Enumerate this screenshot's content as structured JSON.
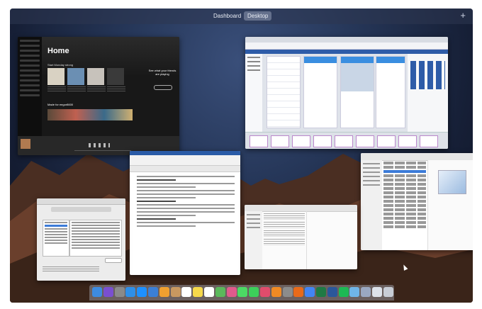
{
  "spaces": {
    "tabs": [
      {
        "label": "Dashboard",
        "active": false
      },
      {
        "label": "Desktop",
        "active": true
      }
    ],
    "add_label": "+"
  },
  "colors": {
    "spotify_bg": "#181818",
    "accent_blue": "#2e5ca8",
    "selection_blue": "#3c7bd8"
  },
  "spotify": {
    "title": "Home",
    "sections": [
      "Start Monday strong",
      "Made for eegor8600"
    ],
    "promo": "See what your friends are playing"
  },
  "dock": {
    "icons": [
      {
        "name": "finder-icon",
        "color": "#3d8be0"
      },
      {
        "name": "siri-icon",
        "color": "#7a4fd0"
      },
      {
        "name": "launchpad-icon",
        "color": "#8a8a8a"
      },
      {
        "name": "safari-icon",
        "color": "#2f8fe8"
      },
      {
        "name": "app-store-icon",
        "color": "#1e90ff"
      },
      {
        "name": "mail-icon",
        "color": "#3b7fd6"
      },
      {
        "name": "photos-icon",
        "color": "#f0a030"
      },
      {
        "name": "contacts-icon",
        "color": "#c89860"
      },
      {
        "name": "calendar-icon",
        "color": "#ffffff"
      },
      {
        "name": "notes-icon",
        "color": "#f6d84a"
      },
      {
        "name": "reminders-icon",
        "color": "#ffffff"
      },
      {
        "name": "maps-icon",
        "color": "#5bb85b"
      },
      {
        "name": "photo-app-icon",
        "color": "#e05a8c"
      },
      {
        "name": "messages-icon",
        "color": "#4cd964"
      },
      {
        "name": "facetime-icon",
        "color": "#3ccf5a"
      },
      {
        "name": "itunes-icon",
        "color": "#e04c6c"
      },
      {
        "name": "ibooks-icon",
        "color": "#f08a24"
      },
      {
        "name": "system-preferences-icon",
        "color": "#8c8c8c"
      },
      {
        "name": "firefox-icon",
        "color": "#e86a1a"
      },
      {
        "name": "chrome-icon",
        "color": "#4285f4"
      },
      {
        "name": "excel-icon",
        "color": "#1f7a44"
      },
      {
        "name": "word-icon",
        "color": "#2b579a"
      },
      {
        "name": "spotify-icon",
        "color": "#1db954"
      },
      {
        "name": "folder-icon",
        "color": "#6fb5e8"
      },
      {
        "name": "downloads-icon",
        "color": "#9aa8c2"
      },
      {
        "name": "documents-icon",
        "color": "#dde2ea"
      },
      {
        "name": "trash-icon",
        "color": "#c8cdd6"
      }
    ]
  }
}
